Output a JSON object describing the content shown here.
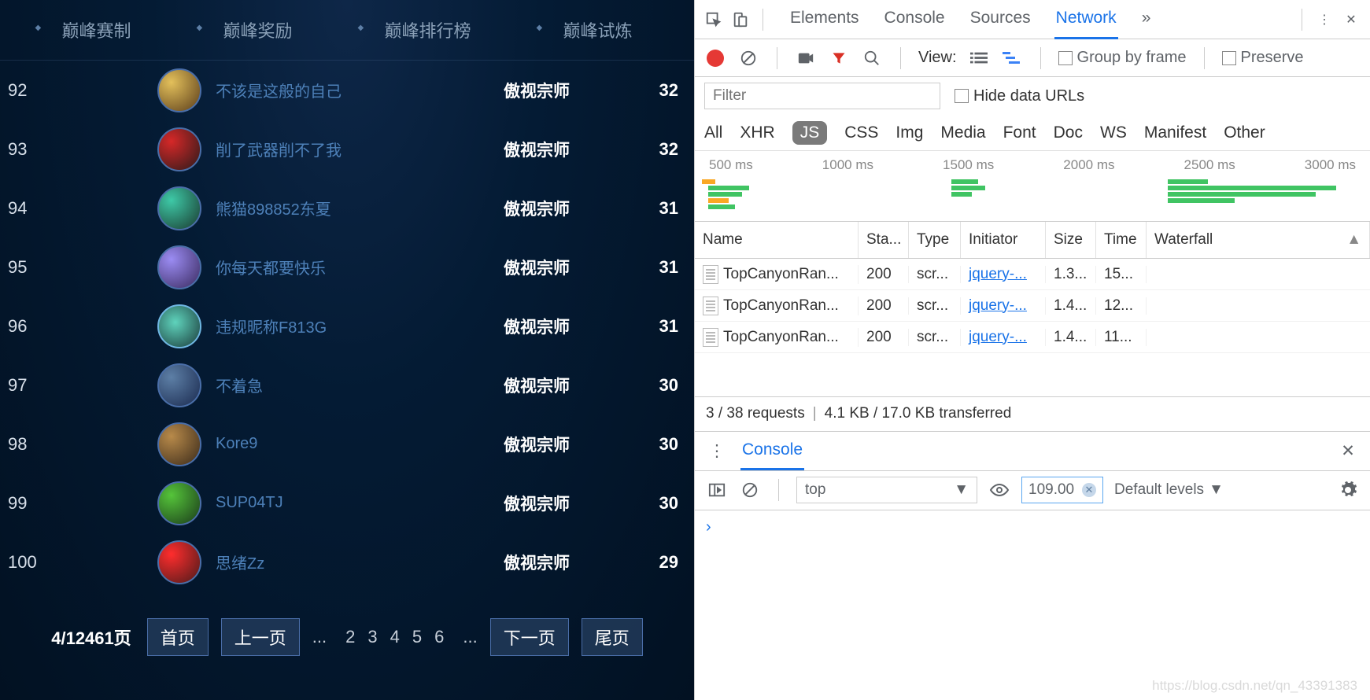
{
  "game": {
    "tabs": [
      "巅峰赛制",
      "巅峰奖励",
      "巅峰排行榜",
      "巅峰试炼"
    ],
    "rows": [
      {
        "rank": "92",
        "name": "不该是这般的自己",
        "tier": "傲视宗师",
        "score": "32"
      },
      {
        "rank": "93",
        "name": "削了武器削不了我",
        "tier": "傲视宗师",
        "score": "32"
      },
      {
        "rank": "94",
        "name": "熊猫898852东夏",
        "tier": "傲视宗师",
        "score": "31"
      },
      {
        "rank": "95",
        "name": "你每天都要快乐",
        "tier": "傲视宗师",
        "score": "31"
      },
      {
        "rank": "96",
        "name": "违规昵称F813G",
        "tier": "傲视宗师",
        "score": "31"
      },
      {
        "rank": "97",
        "name": "不着急",
        "tier": "傲视宗师",
        "score": "30"
      },
      {
        "rank": "98",
        "name": "Kore9",
        "tier": "傲视宗师",
        "score": "30"
      },
      {
        "rank": "99",
        "name": "SUP04TJ",
        "tier": "傲视宗师",
        "score": "30"
      },
      {
        "rank": "100",
        "name": "思绪Zz",
        "tier": "傲视宗师",
        "score": "29"
      }
    ],
    "pagination": {
      "info": "4/12461页",
      "first": "首页",
      "prev": "上一页",
      "dots1": "...",
      "nums": [
        "2",
        "3",
        "4",
        "5",
        "6"
      ],
      "dots2": "...",
      "next": "下一页",
      "last": "尾页"
    }
  },
  "devtools": {
    "tabs": [
      "Elements",
      "Console",
      "Sources",
      "Network"
    ],
    "moreGlyph": "»",
    "toolbar": {
      "viewLabel": "View:",
      "groupByFrame": "Group by frame",
      "preserve": "Preserve"
    },
    "filter": {
      "placeholder": "Filter",
      "hideDataUrls": "Hide data URLs"
    },
    "types": [
      "All",
      "XHR",
      "JS",
      "CSS",
      "Img",
      "Media",
      "Font",
      "Doc",
      "WS",
      "Manifest",
      "Other"
    ],
    "timeline": {
      "ticks": [
        "500 ms",
        "1000 ms",
        "1500 ms",
        "2000 ms",
        "2500 ms",
        "3000 ms"
      ]
    },
    "netHeaders": {
      "name": "Name",
      "status": "Sta...",
      "type": "Type",
      "initiator": "Initiator",
      "size": "Size",
      "time": "Time",
      "waterfall": "Waterfall"
    },
    "netRows": [
      {
        "name": "TopCanyonRan...",
        "status": "200",
        "type": "scr...",
        "initiator": "jquery-...",
        "size": "1.3...",
        "time": "15...",
        "wf": 2
      },
      {
        "name": "TopCanyonRan...",
        "status": "200",
        "type": "scr...",
        "initiator": "jquery-...",
        "size": "1.4...",
        "time": "12...",
        "wf": 52
      },
      {
        "name": "TopCanyonRan...",
        "status": "200",
        "type": "scr...",
        "initiator": "jquery-...",
        "size": "1.4...",
        "time": "11...",
        "wf": 84
      }
    ],
    "netStatus": {
      "a": "3 / 38 requests",
      "b": "4.1 KB / 17.0 KB transferred"
    },
    "console": {
      "label": "Console",
      "context": "top",
      "filterValue": "109.00",
      "levels": "Default levels",
      "prompt": "›"
    }
  },
  "watermark": "https://blog.csdn.net/qn_43391383"
}
